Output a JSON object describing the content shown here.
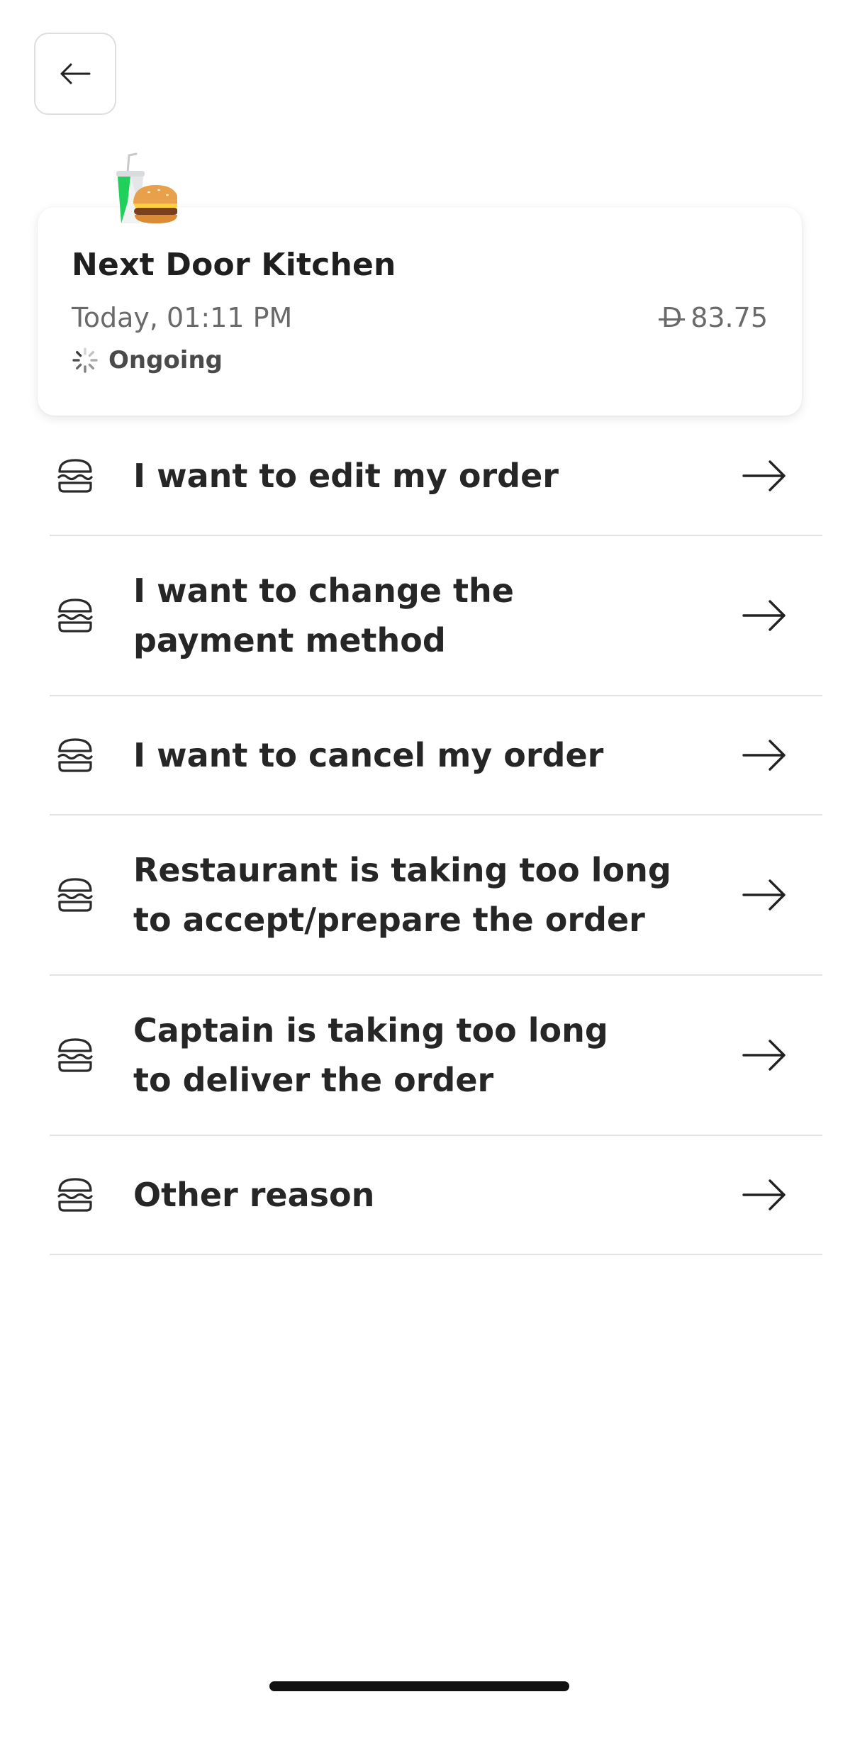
{
  "header": {
    "back_icon": "arrow-left-icon"
  },
  "order": {
    "illustration_icon": "drink-and-burger-icon",
    "restaurant_name": "Next Door Kitchen",
    "time": "Today, 01:11 PM",
    "currency_symbol": "D",
    "amount": "83.75",
    "status_icon": "spinner-icon",
    "status": "Ongoing"
  },
  "reasons": [
    {
      "label": "I want to edit my order",
      "icon": "burger-icon"
    },
    {
      "label": "I want to change the payment method",
      "icon": "burger-icon"
    },
    {
      "label": "I want to cancel my order",
      "icon": "burger-icon"
    },
    {
      "label": "Restaurant is taking too long to accept/prepare the order",
      "icon": "burger-icon"
    },
    {
      "label": "Captain is taking too long to deliver the order",
      "icon": "burger-icon"
    },
    {
      "label": "Other reason",
      "icon": "burger-icon"
    }
  ],
  "colors": {
    "text": "#262626",
    "muted": "#6a6a6a",
    "divider": "#e3e3e3",
    "accent_green": "#1fd15b"
  }
}
